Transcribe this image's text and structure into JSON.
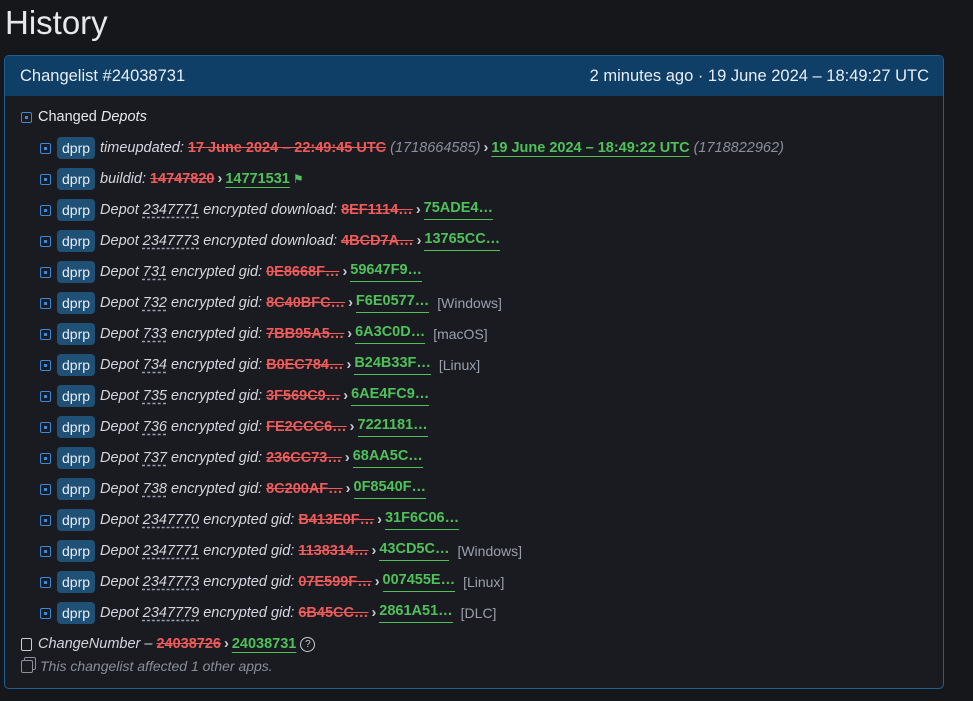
{
  "page": {
    "title": "History"
  },
  "header": {
    "changelist": "Changelist #24038731",
    "time": "2 minutes ago · 19 June 2024 – 18:49:27 UTC"
  },
  "group": {
    "prefix": "Changed",
    "name": "Depots"
  },
  "rows": [
    {
      "tag": "dprp",
      "pre": "timeupdated:",
      "num": "",
      "post": "",
      "old": "17 June 2024 – 22:49:45 UTC",
      "old_ts": "(1718664585)",
      "new": "19 June 2024 – 18:49:22 UTC",
      "new_ts": "(1718822962)",
      "note": ""
    },
    {
      "tag": "dprp",
      "pre": "buildid:",
      "num": "",
      "post": "",
      "old": "14747820",
      "new": "14771531",
      "note": ""
    },
    {
      "tag": "dprp",
      "pre": "Depot ",
      "num": "2347771",
      "post": " encrypted download:",
      "old": "8EF1114…",
      "new": "75ADE4…",
      "note": ""
    },
    {
      "tag": "dprp",
      "pre": "Depot ",
      "num": "2347773",
      "post": " encrypted download:",
      "old": "4BCD7A…",
      "new": "13765CC…",
      "note": ""
    },
    {
      "tag": "dprp",
      "pre": "Depot ",
      "num": "731",
      "post": " encrypted gid:",
      "old": "0E8668F…",
      "new": "59647F9…",
      "note": ""
    },
    {
      "tag": "dprp",
      "pre": "Depot ",
      "num": "732",
      "post": " encrypted gid:",
      "old": "8C40BFC…",
      "new": "F6E0577…",
      "note": "[Windows]"
    },
    {
      "tag": "dprp",
      "pre": "Depot ",
      "num": "733",
      "post": " encrypted gid:",
      "old": "7BB95A5…",
      "new": "6A3C0D…",
      "note": "[macOS]"
    },
    {
      "tag": "dprp",
      "pre": "Depot ",
      "num": "734",
      "post": " encrypted gid:",
      "old": "B0EC784…",
      "new": "B24B33F…",
      "note": "[Linux]"
    },
    {
      "tag": "dprp",
      "pre": "Depot ",
      "num": "735",
      "post": " encrypted gid:",
      "old": "3F569C9…",
      "new": "6AE4FC9…",
      "note": ""
    },
    {
      "tag": "dprp",
      "pre": "Depot ",
      "num": "736",
      "post": " encrypted gid:",
      "old": "FE2CCC6…",
      "new": "7221181…",
      "note": ""
    },
    {
      "tag": "dprp",
      "pre": "Depot ",
      "num": "737",
      "post": " encrypted gid:",
      "old": "236CC73…",
      "new": "68AA5C…",
      "note": ""
    },
    {
      "tag": "dprp",
      "pre": "Depot ",
      "num": "738",
      "post": " encrypted gid:",
      "old": "8C200AF…",
      "new": "0F8540F…",
      "note": ""
    },
    {
      "tag": "dprp",
      "pre": "Depot ",
      "num": "2347770",
      "post": " encrypted gid:",
      "old": "B413E0F…",
      "new": "31F6C06…",
      "note": ""
    },
    {
      "tag": "dprp",
      "pre": "Depot ",
      "num": "2347771",
      "post": " encrypted gid:",
      "old": "1138314…",
      "new": "43CD5C…",
      "note": "[Windows]"
    },
    {
      "tag": "dprp",
      "pre": "Depot ",
      "num": "2347773",
      "post": " encrypted gid:",
      "old": "07E599F…",
      "new": "007455E…",
      "note": "[Linux]"
    },
    {
      "tag": "dprp",
      "pre": "Depot ",
      "num": "2347779",
      "post": " encrypted gid:",
      "old": "6B45CC…",
      "new": "2861A51…",
      "note": "[DLC]"
    }
  ],
  "change_number": {
    "label": "ChangeNumber –",
    "old": "24038726",
    "new": "24038731"
  },
  "footer": {
    "affected": "This changelist affected 1 other apps."
  }
}
